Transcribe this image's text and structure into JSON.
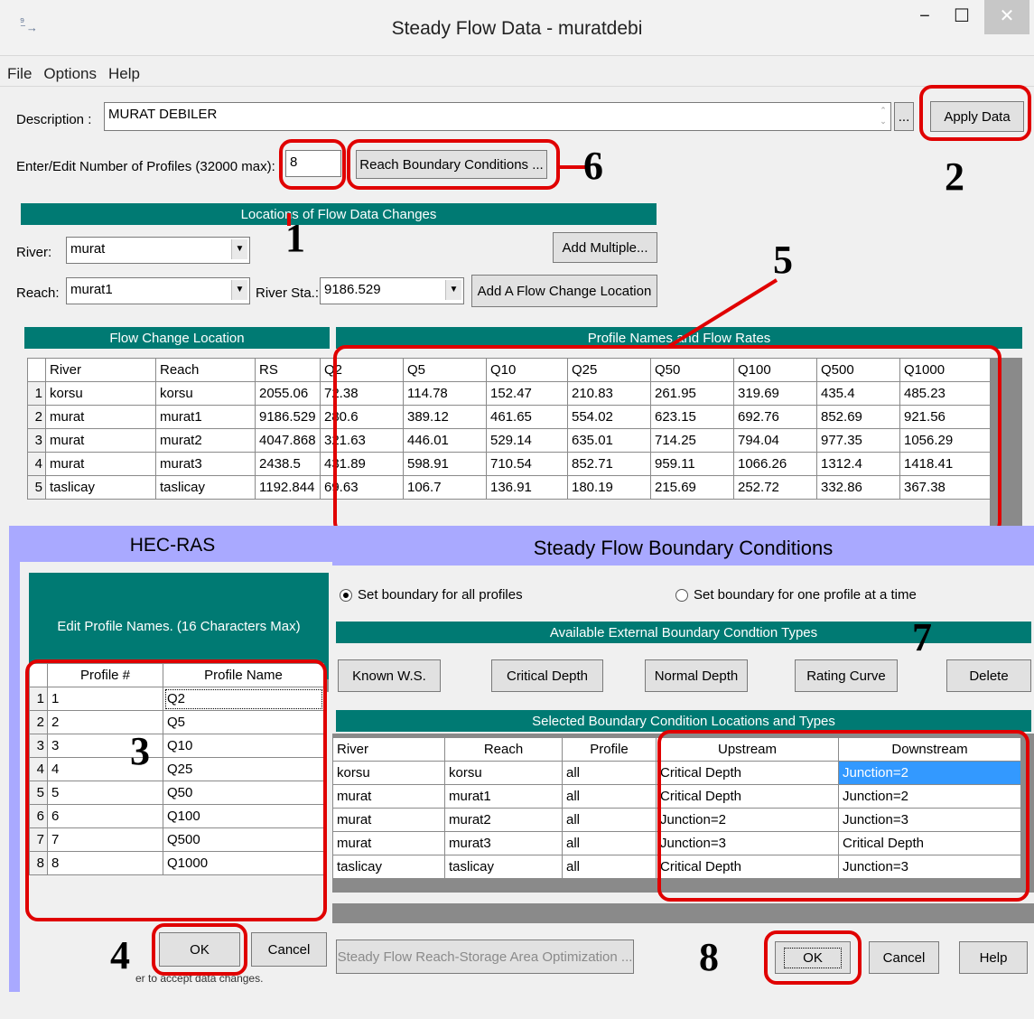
{
  "window": {
    "title": "Steady Flow Data - muratdebi",
    "min": "−",
    "max": "☐",
    "close": "✕"
  },
  "menu": [
    "File",
    "Options",
    "Help"
  ],
  "description": {
    "label": "Description :",
    "value": "MURAT DEBILER",
    "browse": "...",
    "apply": "Apply Data"
  },
  "profiles": {
    "label": "Enter/Edit Number of Profiles (32000 max):",
    "value": "8",
    "reach_bc": "Reach Boundary Conditions ..."
  },
  "locations": {
    "header": "Locations of Flow Data Changes",
    "river_label": "River:",
    "river_value": "murat",
    "reach_label": "Reach:",
    "reach_value": "murat1",
    "sta_label": "River Sta.:",
    "sta_value": "9186.529",
    "add_multiple": "Add Multiple...",
    "add_location": "Add A Flow Change Location"
  },
  "flow_table": {
    "left_header": "Flow Change Location",
    "right_header": "Profile Names and Flow Rates",
    "columns": [
      "River",
      "Reach",
      "RS",
      "Q2",
      "Q5",
      "Q10",
      "Q25",
      "Q50",
      "Q100",
      "Q500",
      "Q1000"
    ],
    "rows": [
      [
        "1",
        "korsu",
        "korsu",
        "2055.06",
        "72.38",
        "114.78",
        "152.47",
        "210.83",
        "261.95",
        "319.69",
        "435.4",
        "485.23"
      ],
      [
        "2",
        "murat",
        "murat1",
        "9186.529",
        "280.6",
        "389.12",
        "461.65",
        "554.02",
        "623.15",
        "692.76",
        "852.69",
        "921.56"
      ],
      [
        "3",
        "murat",
        "murat2",
        "4047.868",
        "321.63",
        "446.01",
        "529.14",
        "635.01",
        "714.25",
        "794.04",
        "977.35",
        "1056.29"
      ],
      [
        "4",
        "murat",
        "murat3",
        "2438.5",
        "431.89",
        "598.91",
        "710.54",
        "852.71",
        "959.11",
        "1066.26",
        "1312.4",
        "1418.41"
      ],
      [
        "5",
        "taslicay",
        "taslicay",
        "1192.844",
        "69.63",
        "106.7",
        "136.91",
        "180.19",
        "215.69",
        "252.72",
        "332.86",
        "367.38"
      ]
    ]
  },
  "hecras": {
    "title": "HEC-RAS",
    "header": "Edit Profile Names. (16 Characters Max)",
    "col_num": "Profile #",
    "col_name": "Profile Name",
    "rows": [
      [
        "1",
        "1",
        "Q2"
      ],
      [
        "2",
        "2",
        "Q5"
      ],
      [
        "3",
        "3",
        "Q10"
      ],
      [
        "4",
        "4",
        "Q25"
      ],
      [
        "5",
        "5",
        "Q50"
      ],
      [
        "6",
        "6",
        "Q100"
      ],
      [
        "7",
        "7",
        "Q500"
      ],
      [
        "8",
        "8",
        "Q1000"
      ]
    ],
    "ok": "OK",
    "cancel": "Cancel",
    "hidden_text": "er to accept data changes."
  },
  "bc": {
    "title": "Steady Flow Boundary Conditions",
    "radio_all": "Set boundary for all profiles",
    "radio_one": "Set boundary for one profile at a time",
    "types_header": "Available External Boundary Condtion Types",
    "buttons": [
      "Known W.S.",
      "Critical Depth",
      "Normal Depth",
      "Rating Curve",
      "Delete"
    ],
    "sel_header": "Selected Boundary Condition Locations and Types",
    "columns": [
      "River",
      "Reach",
      "Profile",
      "Upstream",
      "Downstream"
    ],
    "rows": [
      [
        "korsu",
        "korsu",
        "all",
        "Critical Depth",
        "Junction=2"
      ],
      [
        "murat",
        "murat1",
        "all",
        "Critical Depth",
        "Junction=2"
      ],
      [
        "murat",
        "murat2",
        "all",
        "Junction=2",
        "Junction=3"
      ],
      [
        "murat",
        "murat3",
        "all",
        "Junction=3",
        "Critical Depth"
      ],
      [
        "taslicay",
        "taslicay",
        "all",
        "Critical Depth",
        "Junction=3"
      ]
    ],
    "optimize": "Steady Flow Reach-Storage Area Optimization ...",
    "ok": "OK",
    "cancel": "Cancel",
    "help": "Help"
  },
  "annotations": [
    "1",
    "2",
    "3",
    "4",
    "5",
    "6",
    "7",
    "8"
  ],
  "colors": {
    "teal": "#007a73",
    "red": "#e00000",
    "purple": "#a9a9ff",
    "selected": "#3399ff"
  }
}
